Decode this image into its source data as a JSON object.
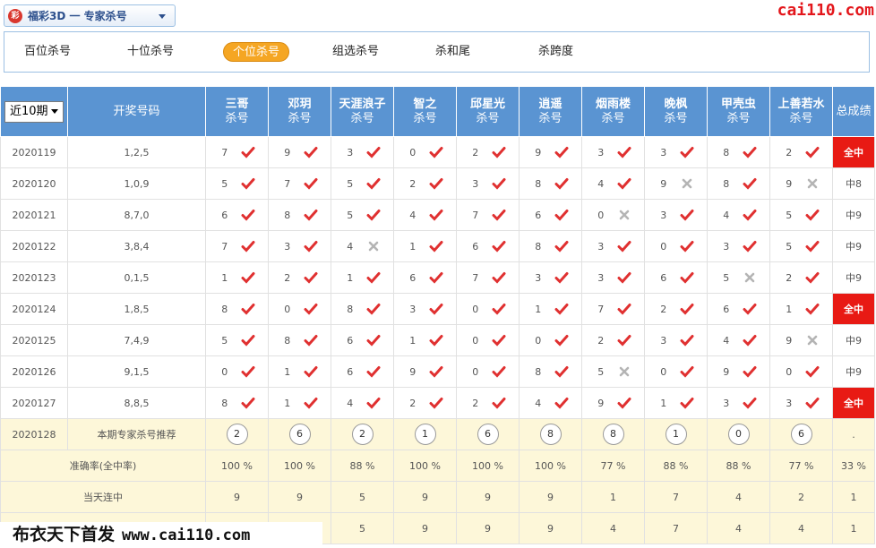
{
  "top": {
    "game_title": "福彩3D 一 专家杀号",
    "game_logo_text": "彩",
    "site_logo": "cai110.com"
  },
  "tabs": [
    "百位杀号",
    "十位杀号",
    "个位杀号",
    "组选杀号",
    "杀和尾",
    "杀跨度"
  ],
  "active_tab": 2,
  "header": {
    "period_label": "近10期",
    "draw_label": "开奖号码",
    "sub_label": "杀号",
    "total_label": "总成绩",
    "experts": [
      "三哥",
      "邓玥",
      "天涯浪子",
      "智之",
      "邱星光",
      "逍遥",
      "烟雨楼",
      "晚枫",
      "甲壳虫",
      "上善若水"
    ]
  },
  "rows": [
    {
      "period": "2020119",
      "draw": "1,2,5",
      "kills": [
        "7",
        "9",
        "3",
        "0",
        "2",
        "9",
        "3",
        "3",
        "8",
        "2"
      ],
      "hits": [
        1,
        1,
        1,
        1,
        1,
        1,
        1,
        1,
        1,
        1
      ],
      "total": "全中",
      "total_red": true
    },
    {
      "period": "2020120",
      "draw": "1,0,9",
      "kills": [
        "5",
        "7",
        "5",
        "2",
        "3",
        "8",
        "4",
        "9",
        "8",
        "9"
      ],
      "hits": [
        1,
        1,
        1,
        1,
        1,
        1,
        1,
        0,
        1,
        0
      ],
      "total": "中8",
      "total_red": false
    },
    {
      "period": "2020121",
      "draw": "8,7,0",
      "kills": [
        "6",
        "8",
        "5",
        "4",
        "7",
        "6",
        "0",
        "3",
        "4",
        "5"
      ],
      "hits": [
        1,
        1,
        1,
        1,
        1,
        1,
        0,
        1,
        1,
        1
      ],
      "total": "中9",
      "total_red": false
    },
    {
      "period": "2020122",
      "draw": "3,8,4",
      "kills": [
        "7",
        "3",
        "4",
        "1",
        "6",
        "8",
        "3",
        "0",
        "3",
        "5"
      ],
      "hits": [
        1,
        1,
        0,
        1,
        1,
        1,
        1,
        1,
        1,
        1
      ],
      "total": "中9",
      "total_red": false
    },
    {
      "period": "2020123",
      "draw": "0,1,5",
      "kills": [
        "1",
        "2",
        "1",
        "6",
        "7",
        "3",
        "3",
        "6",
        "5",
        "2"
      ],
      "hits": [
        1,
        1,
        1,
        1,
        1,
        1,
        1,
        1,
        0,
        1
      ],
      "total": "中9",
      "total_red": false
    },
    {
      "period": "2020124",
      "draw": "1,8,5",
      "kills": [
        "8",
        "0",
        "8",
        "3",
        "0",
        "1",
        "7",
        "2",
        "6",
        "1"
      ],
      "hits": [
        1,
        1,
        1,
        1,
        1,
        1,
        1,
        1,
        1,
        1
      ],
      "total": "全中",
      "total_red": true
    },
    {
      "period": "2020125",
      "draw": "7,4,9",
      "kills": [
        "5",
        "8",
        "6",
        "1",
        "0",
        "0",
        "2",
        "3",
        "4",
        "9"
      ],
      "hits": [
        1,
        1,
        1,
        1,
        1,
        1,
        1,
        1,
        1,
        0
      ],
      "total": "中9",
      "total_red": false
    },
    {
      "period": "2020126",
      "draw": "9,1,5",
      "kills": [
        "0",
        "1",
        "6",
        "9",
        "0",
        "8",
        "5",
        "0",
        "9",
        "0"
      ],
      "hits": [
        1,
        1,
        1,
        1,
        1,
        1,
        0,
        1,
        1,
        1
      ],
      "total": "中9",
      "total_red": false
    },
    {
      "period": "2020127",
      "draw": "8,8,5",
      "kills": [
        "8",
        "1",
        "4",
        "2",
        "2",
        "4",
        "9",
        "1",
        "3",
        "3"
      ],
      "hits": [
        1,
        1,
        1,
        1,
        1,
        1,
        1,
        1,
        1,
        1
      ],
      "total": "全中",
      "total_red": true
    }
  ],
  "recommend": {
    "period": "2020128",
    "label": "本期专家杀号推荐",
    "nums": [
      "2",
      "6",
      "2",
      "1",
      "6",
      "8",
      "8",
      "1",
      "0",
      "6"
    ],
    "total": "."
  },
  "accuracy": {
    "label": "准确率(全中率)",
    "values": [
      "100 %",
      "100 %",
      "88 %",
      "100 %",
      "100 %",
      "100 %",
      "77 %",
      "88 %",
      "88 %",
      "77 %"
    ],
    "total": "33 %"
  },
  "streak_today": {
    "label": "当天连中",
    "values": [
      "9",
      "9",
      "5",
      "9",
      "9",
      "9",
      "1",
      "7",
      "4",
      "2"
    ],
    "total": "1"
  },
  "streak_last": {
    "label": "",
    "values": [
      "",
      "",
      "5",
      "9",
      "9",
      "9",
      "4",
      "7",
      "4",
      "4"
    ],
    "total": "1"
  },
  "watermark": {
    "text": "布衣天下首发",
    "url": "www.cai110.com"
  },
  "colors": {
    "header_blue": "#5a94d2",
    "accent_orange": "#f5a623",
    "hit_red": "#e03030",
    "miss_gray": "#b4b4b4",
    "total_red_bg": "#e81a14"
  }
}
